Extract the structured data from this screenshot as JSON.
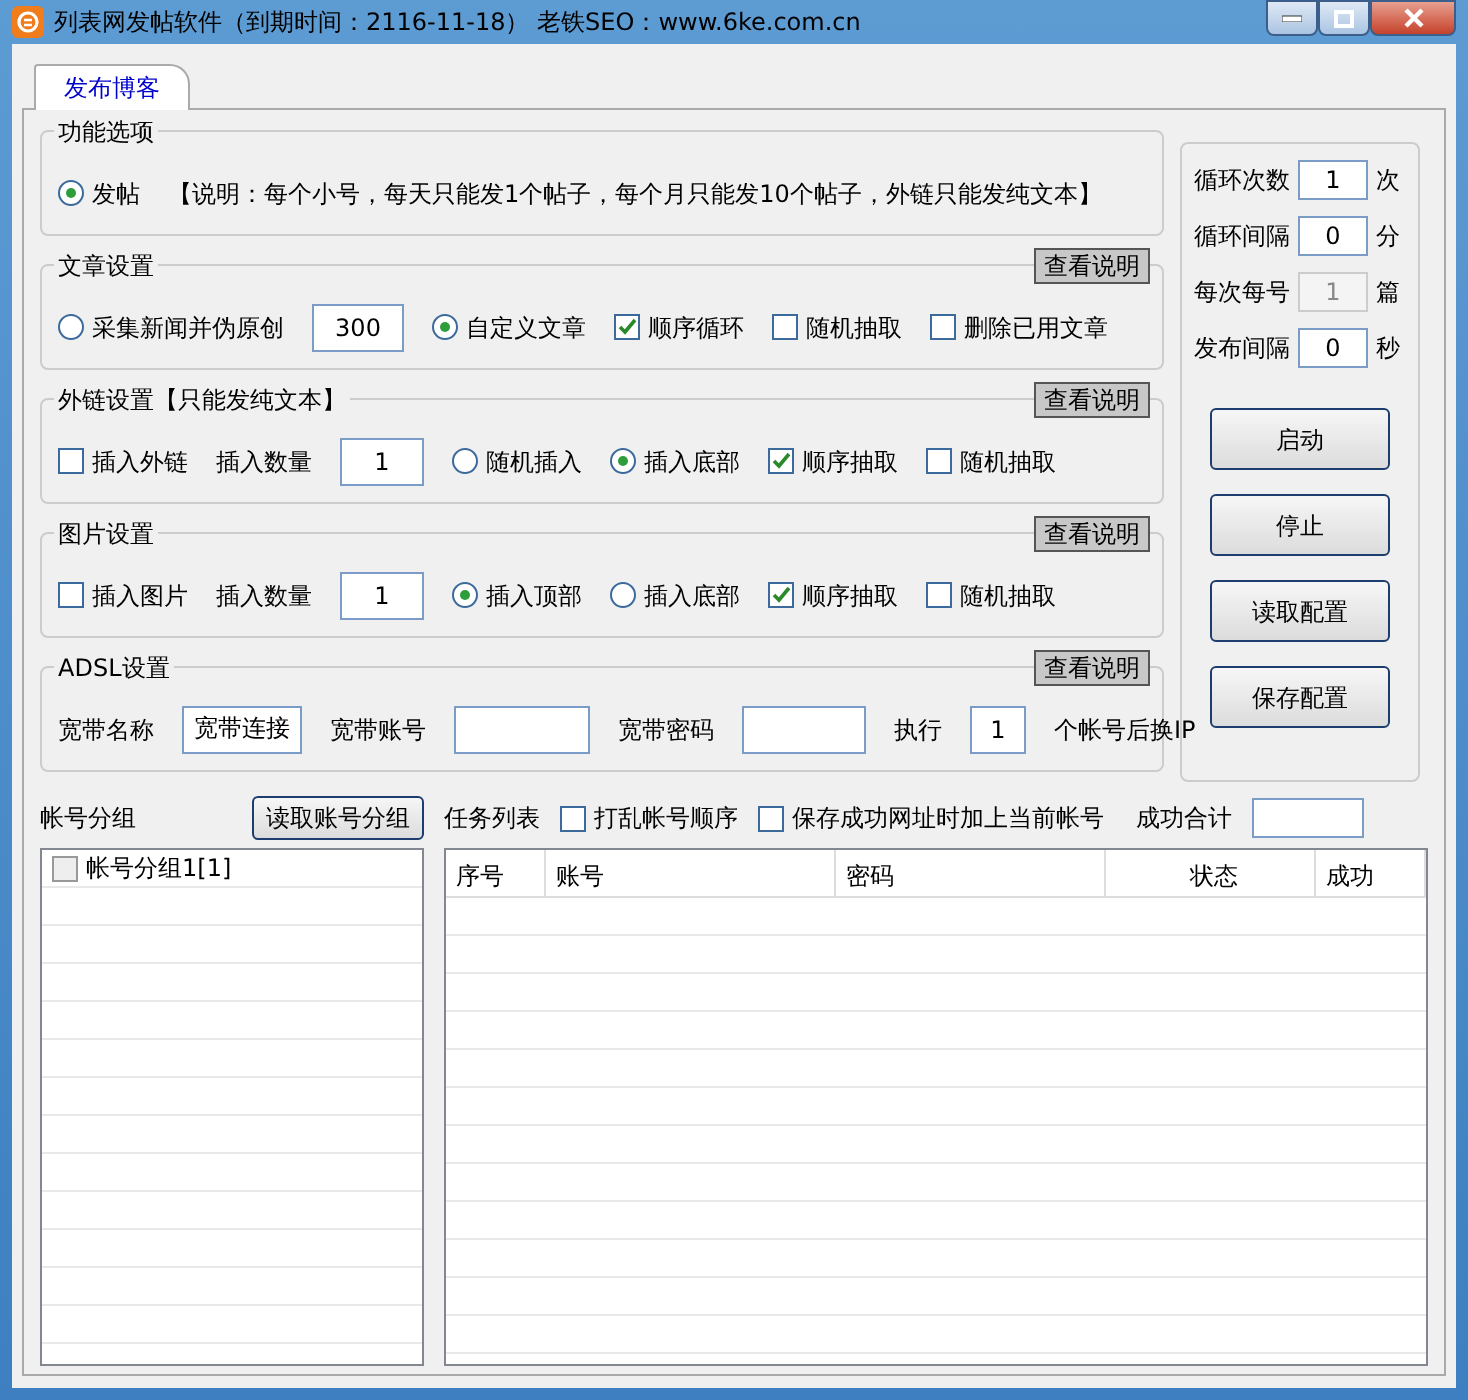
{
  "window": {
    "title": "列表网发帖软件（到期时间：2116-11-18） 老铁SEO：www.6ke.com.cn"
  },
  "tabs": [
    {
      "label": "发布博客",
      "selected": true
    }
  ],
  "groups": [
    {
      "title": "功能选项",
      "items": [
        {
          "kind": "radio",
          "label": "发帖",
          "selected": true
        },
        {
          "kind": "text",
          "label": "【说明：每个小号，每天只能发1个帖子，每个月只能发10个帖子，外链只能发纯文本】"
        }
      ]
    },
    {
      "title": "文章设置",
      "help_button": "查看说明",
      "items": [
        {
          "kind": "radio",
          "label": "采集新闻并伪原创",
          "selected": false
        },
        {
          "kind": "field",
          "value": "300"
        },
        {
          "kind": "radio",
          "label": "自定义文章",
          "selected": true
        },
        {
          "kind": "checkbox",
          "label": "顺序循环",
          "checked": true
        },
        {
          "kind": "checkbox",
          "label": "随机抽取",
          "checked": false
        },
        {
          "kind": "checkbox",
          "label": "删除已用文章",
          "checked": false
        }
      ]
    },
    {
      "title": "外链设置【只能发纯文本】",
      "help_button": "查看说明",
      "items": [
        {
          "kind": "checkbox",
          "label": "插入外链",
          "checked": false
        },
        {
          "kind": "text",
          "label": "插入数量"
        },
        {
          "kind": "field",
          "value": "1"
        },
        {
          "kind": "radio",
          "label": "随机插入",
          "selected": false
        },
        {
          "kind": "radio",
          "label": "插入底部",
          "selected": true
        },
        {
          "kind": "checkbox",
          "label": "顺序抽取",
          "checked": true
        },
        {
          "kind": "checkbox",
          "label": "随机抽取",
          "checked": false
        }
      ]
    },
    {
      "title": "图片设置",
      "help_button": "查看说明",
      "items": [
        {
          "kind": "checkbox",
          "label": "插入图片",
          "checked": false
        },
        {
          "kind": "text",
          "label": "插入数量"
        },
        {
          "kind": "field",
          "value": "1"
        },
        {
          "kind": "radio",
          "label": "插入顶部",
          "selected": true
        },
        {
          "kind": "radio",
          "label": "插入底部",
          "selected": false
        },
        {
          "kind": "checkbox",
          "label": "顺序抽取",
          "checked": true
        },
        {
          "kind": "checkbox",
          "label": "随机抽取",
          "checked": false
        }
      ]
    },
    {
      "title": "ADSL设置",
      "help_button": "查看说明",
      "items": [
        {
          "kind": "text",
          "label": "宽带名称"
        },
        {
          "kind": "field",
          "value": "宽带连接"
        },
        {
          "kind": "text",
          "label": "宽带账号"
        },
        {
          "kind": "field"
        },
        {
          "kind": "text",
          "label": "宽带密码"
        },
        {
          "kind": "field"
        },
        {
          "kind": "text",
          "label": "执行"
        },
        {
          "kind": "field",
          "value": "1"
        },
        {
          "kind": "text",
          "label": "个帐号后换IP"
        }
      ]
    }
  ],
  "side_panel": {
    "fields": [
      {
        "label": "循环次数",
        "value": "1",
        "unit": "次",
        "disabled": false
      },
      {
        "label": "循环间隔",
        "value": "0",
        "unit": "分",
        "disabled": false
      },
      {
        "label": "每次每号",
        "value": "1",
        "unit": "篇",
        "disabled": true
      },
      {
        "label": "发布间隔",
        "value": "0",
        "unit": "秒",
        "disabled": false
      }
    ],
    "buttons": [
      "启动",
      "停止",
      "读取配置",
      "保存配置"
    ]
  },
  "account_groups": {
    "title": "帐号分组",
    "button": "读取账号分组",
    "items": [
      {
        "label": "帐号分组1[1]",
        "checked": false
      }
    ]
  },
  "task_list": {
    "title": "任务列表",
    "options": [
      {
        "label": "打乱帐号顺序",
        "checked": false
      },
      {
        "label": "保存成功网址时加上当前帐号",
        "checked": false
      }
    ],
    "total_label": "成功合计",
    "columns": [
      "序号",
      "账号",
      "密码",
      "状态",
      "成功"
    ]
  }
}
